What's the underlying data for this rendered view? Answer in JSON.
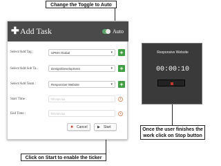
{
  "annotations": {
    "toggle": "Change the Toggle to Auto",
    "start": "Click on Start to enable the ticker",
    "stop_line1": "Once the user finishes the",
    "stop_line2": "work click on Stop button"
  },
  "add_task": {
    "title": "Add Task",
    "toggle_label": "Auto",
    "toggle_state": "on",
    "fields": [
      {
        "label": "Select/Add Tag :",
        "value": "UPMA Global"
      },
      {
        "label": "Select/Add Sub Ta..",
        "value": "Design/Development"
      },
      {
        "label": "Select/Add Team :",
        "value": "Responsive Website"
      }
    ],
    "start_time": {
      "label": "Start Time :",
      "placeholder": "hh:mm aa"
    },
    "end_time": {
      "label": "End Time :",
      "placeholder": "hh:mm aa"
    },
    "buttons": {
      "cancel": "Cancel",
      "start": "Start"
    }
  },
  "timer": {
    "title": "Responsive Website",
    "elapsed": "00:00:10"
  },
  "colors": {
    "header_bg": "#4a4a4a",
    "toggle_on": "#5aa36b",
    "add_button": "#3f9e3f",
    "timer_bg": "#3a3a3a",
    "stop_red": "#c0392b",
    "clock_icon": "#d6906a"
  }
}
